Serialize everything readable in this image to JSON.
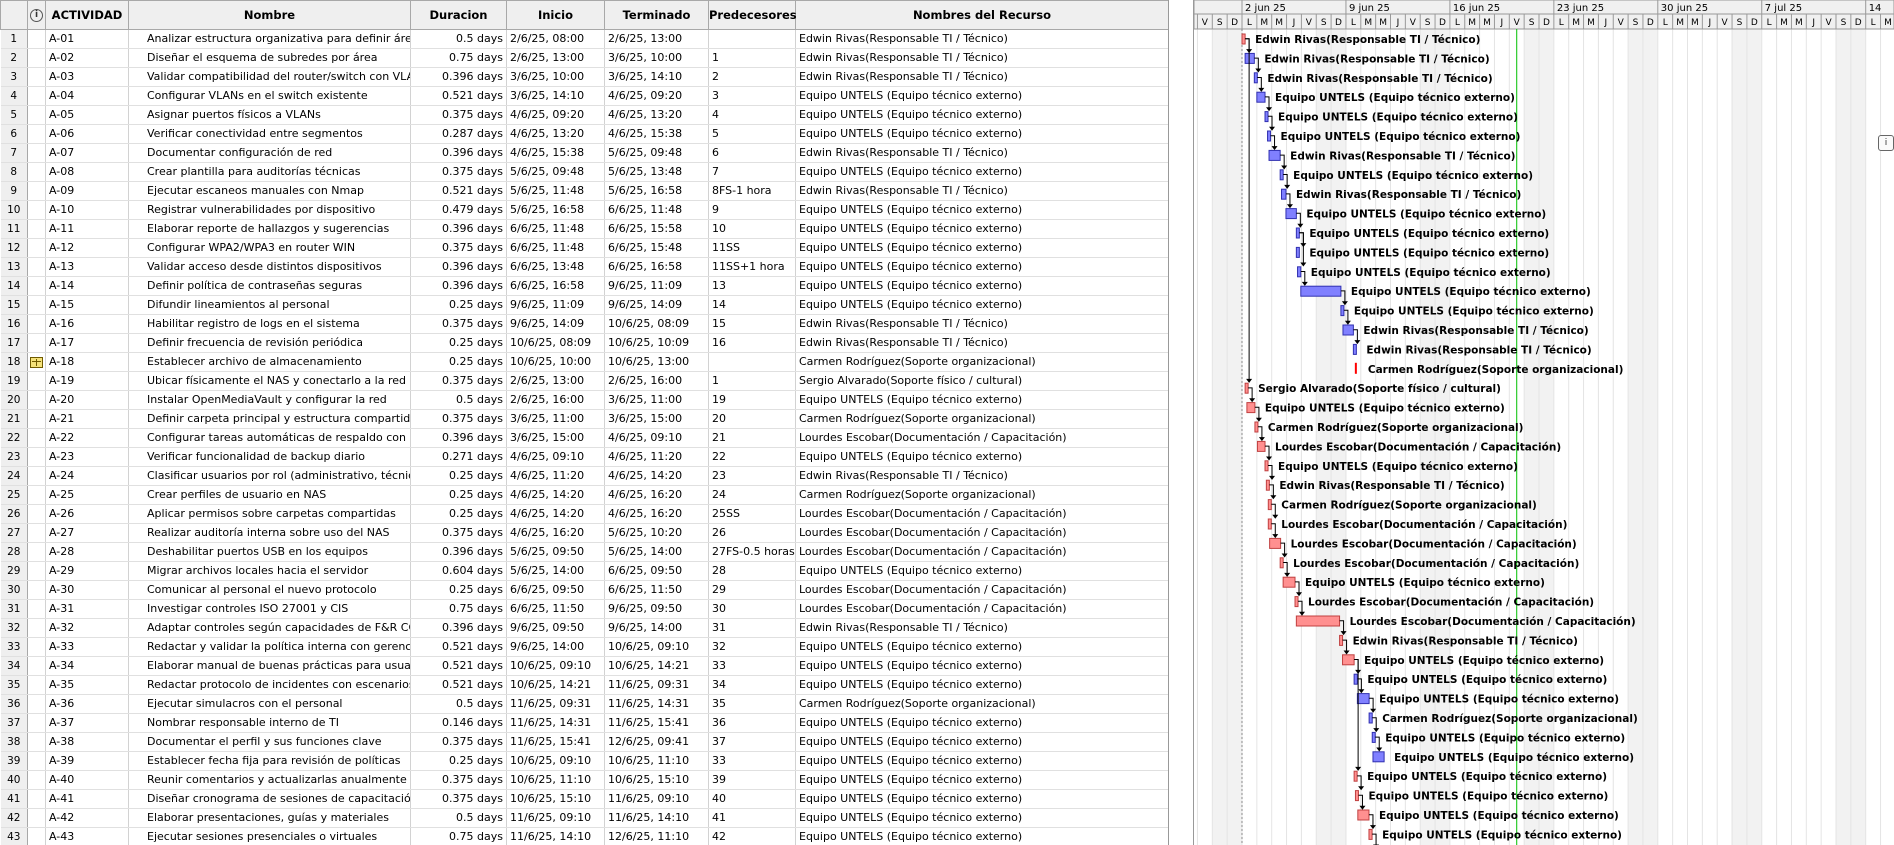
{
  "columns": {
    "info_icon": "info-icon",
    "actividad": "ACTIVIDAD",
    "nombre": "Nombre",
    "duracion": "Duracion",
    "inicio": "Inicio",
    "terminado": "Terminado",
    "predecesores": "Predecesores",
    "recursos": "Nombres del Recurso"
  },
  "colors": {
    "blue_bar": "#8080ff",
    "red_bar": "#ff9090",
    "milestone_red": "#ff0000",
    "today_line": "#00c000"
  },
  "tasks": [
    {
      "id": "1",
      "code": "A-01",
      "name": "Analizar estructura organizativa para definir áreas lógicas",
      "dur": "0.5 days",
      "start": "2/6/25, 08:00",
      "finish": "2/6/25, 13:00",
      "pred": "",
      "res": "Edwin Rivas(Responsable TI / Técnico)",
      "d0": 0,
      "d1": 0.21,
      "color": "red"
    },
    {
      "id": "2",
      "code": "A-02",
      "name": "Diseñar el esquema de subredes por área",
      "dur": "0.75 days",
      "start": "2/6/25, 13:00",
      "finish": "3/6/25, 10:00",
      "pred": "1",
      "res": "Edwin Rivas(Responsable TI / Técnico)",
      "d0": 0.21,
      "d1": 0.83,
      "color": "blue"
    },
    {
      "id": "3",
      "code": "A-03",
      "name": "Validar compatibilidad del router/switch con VLAN",
      "dur": "0.396 days",
      "start": "3/6/25, 10:00",
      "finish": "3/6/25, 14:10",
      "pred": "2",
      "res": "Edwin Rivas(Responsable TI / Técnico)",
      "d0": 0.83,
      "d1": 1.0,
      "color": "blue"
    },
    {
      "id": "4",
      "code": "A-04",
      "name": "Configurar VLANs en el switch existente",
      "dur": "0.521 days",
      "start": "3/6/25, 14:10",
      "finish": "4/6/25, 09:20",
      "pred": "3",
      "res": "Equipo UNTELS (Equipo técnico externo)",
      "d0": 1.0,
      "d1": 1.55,
      "color": "blue"
    },
    {
      "id": "5",
      "code": "A-05",
      "name": "Asignar puertos físicos a VLANs",
      "dur": "0.375 days",
      "start": "4/6/25, 09:20",
      "finish": "4/6/25, 13:20",
      "pred": "4",
      "res": "Equipo UNTELS (Equipo técnico externo)",
      "d0": 1.55,
      "d1": 1.72,
      "color": "blue"
    },
    {
      "id": "6",
      "code": "A-06",
      "name": "Verificar conectividad entre segmentos",
      "dur": "0.287 days",
      "start": "4/6/25, 13:20",
      "finish": "4/6/25, 15:38",
      "pred": "5",
      "res": "Equipo UNTELS (Equipo técnico externo)",
      "d0": 1.72,
      "d1": 1.82,
      "color": "blue"
    },
    {
      "id": "7",
      "code": "A-07",
      "name": "Documentar configuración de red",
      "dur": "0.396 days",
      "start": "4/6/25, 15:38",
      "finish": "5/6/25, 09:48",
      "pred": "6",
      "res": "Edwin Rivas(Responsable TI / Técnico)",
      "d0": 1.82,
      "d1": 2.57,
      "color": "blue"
    },
    {
      "id": "8",
      "code": "A-08",
      "name": "Crear plantilla para auditorías técnicas",
      "dur": "0.375 days",
      "start": "5/6/25, 09:48",
      "finish": "5/6/25, 13:48",
      "pred": "7",
      "res": "Equipo UNTELS (Equipo técnico externo)",
      "d0": 2.57,
      "d1": 2.74,
      "color": "blue"
    },
    {
      "id": "9",
      "code": "A-09",
      "name": "Ejecutar escaneos manuales con Nmap",
      "dur": "0.521 days",
      "start": "5/6/25, 11:48",
      "finish": "5/6/25, 16:58",
      "pred": "8FS-1 hora",
      "res": "Edwin Rivas(Responsable TI / Técnico)",
      "d0": 2.66,
      "d1": 2.96,
      "color": "blue"
    },
    {
      "id": "10",
      "code": "A-10",
      "name": "Registrar vulnerabilidades por dispositivo",
      "dur": "0.479 days",
      "start": "5/6/25, 16:58",
      "finish": "6/6/25, 11:48",
      "pred": "9",
      "res": "Equipo UNTELS (Equipo técnico externo)",
      "d0": 2.96,
      "d1": 3.66,
      "color": "blue"
    },
    {
      "id": "11",
      "code": "A-11",
      "name": "Elaborar reporte de hallazgos y sugerencias",
      "dur": "0.396 days",
      "start": "6/6/25, 11:48",
      "finish": "6/6/25, 15:58",
      "pred": "10",
      "res": "Equipo UNTELS (Equipo técnico externo)",
      "d0": 3.66,
      "d1": 3.83,
      "color": "blue"
    },
    {
      "id": "12",
      "code": "A-12",
      "name": "Configurar WPA2/WPA3 en router WIN",
      "dur": "0.375 days",
      "start": "6/6/25, 11:48",
      "finish": "6/6/25, 15:48",
      "pred": "11SS",
      "res": "Equipo UNTELS (Equipo técnico externo)",
      "d0": 3.66,
      "d1": 3.83,
      "color": "blue"
    },
    {
      "id": "13",
      "code": "A-13",
      "name": "Validar acceso desde distintos dispositivos",
      "dur": "0.396 days",
      "start": "6/6/25, 13:48",
      "finish": "6/6/25, 16:58",
      "pred": "11SS+1 hora",
      "res": "Equipo UNTELS (Equipo técnico externo)",
      "d0": 3.74,
      "d1": 3.96,
      "color": "blue"
    },
    {
      "id": "14",
      "code": "A-14",
      "name": "Definir política de contraseñas seguras",
      "dur": "0.396 days",
      "start": "6/6/25, 16:58",
      "finish": "9/6/25, 11:09",
      "pred": "13",
      "res": "Equipo UNTELS (Equipo técnico externo)",
      "d0": 3.96,
      "d1": 6.66,
      "color": "blue"
    },
    {
      "id": "15",
      "code": "A-15",
      "name": "Difundir lineamientos al personal",
      "dur": "0.25 days",
      "start": "9/6/25, 11:09",
      "finish": "9/6/25, 14:09",
      "pred": "14",
      "res": "Equipo UNTELS (Equipo técnico externo)",
      "d0": 6.66,
      "d1": 6.8,
      "color": "blue"
    },
    {
      "id": "16",
      "code": "A-16",
      "name": "Habilitar registro de logs en el sistema",
      "dur": "0.375 days",
      "start": "9/6/25, 14:09",
      "finish": "10/6/25, 08:09",
      "pred": "15",
      "res": "Edwin Rivas(Responsable TI / Técnico)",
      "d0": 6.8,
      "d1": 7.5,
      "color": "blue"
    },
    {
      "id": "17",
      "code": "A-17",
      "name": "Definir frecuencia de revisión periódica",
      "dur": "0.25 days",
      "start": "10/6/25, 08:09",
      "finish": "10/6/25, 10:09",
      "pred": "16",
      "res": "Edwin Rivas(Responsable TI / Técnico)",
      "d0": 7.5,
      "d1": 7.6,
      "color": "blue"
    },
    {
      "id": "18",
      "code": "A-18",
      "name": "Establecer archivo de almacenamiento",
      "dur": "0.25 days",
      "start": "10/6/25, 10:00",
      "finish": "10/6/25, 13:00",
      "pred": "",
      "res": "Carmen Rodríguez(Soporte organizacional)",
      "d0": 7.6,
      "d1": 7.62,
      "color": "milestone",
      "indicator": true
    },
    {
      "id": "19",
      "code": "A-19",
      "name": "Ubicar físicamente el NAS y conectarlo a la red",
      "dur": "0.375 days",
      "start": "2/6/25, 13:00",
      "finish": "2/6/25, 16:00",
      "pred": "1",
      "res": "Sergio Alvarado(Soporte físico / cultural)",
      "d0": 0.21,
      "d1": 0.33,
      "color": "red"
    },
    {
      "id": "20",
      "code": "A-20",
      "name": "Instalar OpenMediaVault y configurar la red",
      "dur": "0.5 days",
      "start": "2/6/25, 16:00",
      "finish": "3/6/25, 11:00",
      "pred": "19",
      "res": "Equipo UNTELS (Equipo técnico externo)",
      "d0": 0.33,
      "d1": 0.87,
      "color": "red"
    },
    {
      "id": "21",
      "code": "A-21",
      "name": "Definir carpeta principal y estructura compartida",
      "dur": "0.375 days",
      "start": "3/6/25, 11:00",
      "finish": "3/6/25, 15:00",
      "pred": "20",
      "res": "Carmen Rodríguez(Soporte organizacional)",
      "d0": 0.87,
      "d1": 1.04,
      "color": "red"
    },
    {
      "id": "22",
      "code": "A-22",
      "name": "Configurar tareas automáticas de respaldo con Cron",
      "dur": "0.396 days",
      "start": "3/6/25, 15:00",
      "finish": "4/6/25, 09:10",
      "pred": "21",
      "res": "Lourdes Escobar(Documentación / Capacitación)",
      "d0": 1.04,
      "d1": 1.55,
      "color": "red"
    },
    {
      "id": "23",
      "code": "A-23",
      "name": "Verificar funcionalidad de backup diario",
      "dur": "0.271 days",
      "start": "4/6/25, 09:10",
      "finish": "4/6/25, 11:20",
      "pred": "22",
      "res": "Equipo UNTELS (Equipo técnico externo)",
      "d0": 1.55,
      "d1": 1.64,
      "color": "red"
    },
    {
      "id": "24",
      "code": "A-24",
      "name": "Clasificar usuarios por rol (administrativo, técnico)",
      "dur": "0.25 days",
      "start": "4/6/25, 11:20",
      "finish": "4/6/25, 14:20",
      "pred": "23",
      "res": "Edwin Rivas(Responsable TI / Técnico)",
      "d0": 1.64,
      "d1": 1.77,
      "color": "red"
    },
    {
      "id": "25",
      "code": "A-25",
      "name": "Crear perfiles de usuario en NAS",
      "dur": "0.25 days",
      "start": "4/6/25, 14:20",
      "finish": "4/6/25, 16:20",
      "pred": "24",
      "res": "Carmen Rodríguez(Soporte organizacional)",
      "d0": 1.77,
      "d1": 1.86,
      "color": "red"
    },
    {
      "id": "26",
      "code": "A-26",
      "name": "Aplicar permisos sobre carpetas compartidas",
      "dur": "0.25 days",
      "start": "4/6/25, 14:20",
      "finish": "4/6/25, 16:20",
      "pred": "25SS",
      "res": "Lourdes Escobar(Documentación / Capacitación)",
      "d0": 1.77,
      "d1": 1.86,
      "color": "red"
    },
    {
      "id": "27",
      "code": "A-27",
      "name": "Realizar auditoría interna sobre uso del NAS",
      "dur": "0.375 days",
      "start": "4/6/25, 16:20",
      "finish": "5/6/25, 10:20",
      "pred": "26",
      "res": "Lourdes Escobar(Documentación / Capacitación)",
      "d0": 1.86,
      "d1": 2.6,
      "color": "red"
    },
    {
      "id": "28",
      "code": "A-28",
      "name": "Deshabilitar puertos USB en los equipos",
      "dur": "0.396 days",
      "start": "5/6/25, 09:50",
      "finish": "5/6/25, 14:00",
      "pred": "27FS-0.5 horas",
      "res": "Lourdes Escobar(Documentación / Capacitación)",
      "d0": 2.57,
      "d1": 2.77,
      "color": "red"
    },
    {
      "id": "29",
      "code": "A-29",
      "name": "Migrar archivos locales hacia el servidor",
      "dur": "0.604 days",
      "start": "5/6/25, 14:00",
      "finish": "6/6/25, 09:50",
      "pred": "28",
      "res": "Equipo UNTELS (Equipo técnico externo)",
      "d0": 2.77,
      "d1": 3.57,
      "color": "red"
    },
    {
      "id": "30",
      "code": "A-30",
      "name": "Comunicar al personal el nuevo protocolo",
      "dur": "0.25 days",
      "start": "6/6/25, 09:50",
      "finish": "6/6/25, 11:50",
      "pred": "29",
      "res": "Lourdes Escobar(Documentación / Capacitación)",
      "d0": 3.57,
      "d1": 3.66,
      "color": "red"
    },
    {
      "id": "31",
      "code": "A-31",
      "name": "Investigar controles ISO 27001 y CIS",
      "dur": "0.75 days",
      "start": "6/6/25, 11:50",
      "finish": "9/6/25, 09:50",
      "pred": "30",
      "res": "Lourdes Escobar(Documentación / Capacitación)",
      "d0": 3.66,
      "d1": 6.57,
      "color": "red"
    },
    {
      "id": "32",
      "code": "A-32",
      "name": "Adaptar controles según capacidades de F&R CORP",
      "dur": "0.396 days",
      "start": "9/6/25, 09:50",
      "finish": "9/6/25, 14:00",
      "pred": "31",
      "res": "Edwin Rivas(Responsable TI / Técnico)",
      "d0": 6.57,
      "d1": 6.77,
      "color": "red"
    },
    {
      "id": "33",
      "code": "A-33",
      "name": "Redactar y validar la política interna con gerencia",
      "dur": "0.521 days",
      "start": "9/6/25, 14:00",
      "finish": "10/6/25, 09:10",
      "pred": "32",
      "res": "Equipo UNTELS (Equipo técnico externo)",
      "d0": 6.77,
      "d1": 7.55,
      "color": "red"
    },
    {
      "id": "34",
      "code": "A-34",
      "name": "Elaborar manual de buenas prácticas para usuarios",
      "dur": "0.521 days",
      "start": "10/6/25, 09:10",
      "finish": "10/6/25, 14:21",
      "pred": "33",
      "res": "Equipo UNTELS (Equipo técnico externo)",
      "d0": 7.55,
      "d1": 7.77,
      "color": "blue"
    },
    {
      "id": "35",
      "code": "A-35",
      "name": "Redactar protocolo de incidentes con escenarios reales",
      "dur": "0.521 days",
      "start": "10/6/25, 14:21",
      "finish": "11/6/25, 09:31",
      "pred": "34",
      "res": "Equipo UNTELS (Equipo técnico externo)",
      "d0": 7.77,
      "d1": 8.56,
      "color": "blue"
    },
    {
      "id": "36",
      "code": "A-36",
      "name": "Ejecutar simulacros con el personal",
      "dur": "0.5 days",
      "start": "11/6/25, 09:31",
      "finish": "11/6/25, 14:31",
      "pred": "35",
      "res": "Carmen Rodríguez(Soporte organizacional)",
      "d0": 8.56,
      "d1": 8.77,
      "color": "blue"
    },
    {
      "id": "37",
      "code": "A-37",
      "name": "Nombrar responsable interno de TI",
      "dur": "0.146 days",
      "start": "11/6/25, 14:31",
      "finish": "11/6/25, 15:41",
      "pred": "36",
      "res": "Equipo UNTELS (Equipo técnico externo)",
      "d0": 8.77,
      "d1": 8.82,
      "color": "blue"
    },
    {
      "id": "38",
      "code": "A-38",
      "name": "Documentar el perfil y sus funciones clave",
      "dur": "0.375 days",
      "start": "11/6/25, 15:41",
      "finish": "12/6/25, 09:41",
      "pred": "37",
      "res": "Equipo UNTELS (Equipo técnico externo)",
      "d0": 8.82,
      "d1": 9.57,
      "color": "blue"
    },
    {
      "id": "39",
      "code": "A-39",
      "name": "Establecer fecha fija para revisión de políticas",
      "dur": "0.25 days",
      "start": "10/6/25, 09:10",
      "finish": "10/6/25, 11:10",
      "pred": "33",
      "res": "Equipo UNTELS (Equipo técnico externo)",
      "d0": 7.55,
      "d1": 7.64,
      "color": "red"
    },
    {
      "id": "40",
      "code": "A-40",
      "name": "Reunir comentarios y actualizarlas anualmente",
      "dur": "0.375 days",
      "start": "10/6/25, 11:10",
      "finish": "10/6/25, 15:10",
      "pred": "39",
      "res": "Equipo UNTELS (Equipo técnico externo)",
      "d0": 7.64,
      "d1": 7.8,
      "color": "red"
    },
    {
      "id": "41",
      "code": "A-41",
      "name": "Diseñar cronograma de sesiones de capacitación",
      "dur": "0.375 days",
      "start": "10/6/25, 15:10",
      "finish": "11/6/25, 09:10",
      "pred": "40",
      "res": "Equipo UNTELS (Equipo técnico externo)",
      "d0": 7.8,
      "d1": 8.55,
      "color": "red"
    },
    {
      "id": "42",
      "code": "A-42",
      "name": "Elaborar presentaciones, guías y materiales",
      "dur": "0.5 days",
      "start": "11/6/25, 09:10",
      "finish": "11/6/25, 14:10",
      "pred": "41",
      "res": "Equipo UNTELS (Equipo técnico externo)",
      "d0": 8.55,
      "d1": 8.76,
      "color": "red"
    },
    {
      "id": "43",
      "code": "A-43",
      "name": "Ejecutar sesiones presenciales o virtuales",
      "dur": "0.75 days",
      "start": "11/6/25, 14:10",
      "finish": "12/6/25, 11:10",
      "pred": "42",
      "res": "Equipo UNTELS (Equipo técnico externo)",
      "d0": 8.76,
      "d1": 9.63,
      "color": "red"
    }
  ],
  "gantt": {
    "weeks": [
      "2 jun 25",
      "9 jun 25",
      "16 jun 25",
      "23 jun 25",
      "30 jun 25",
      "7 jul 25",
      "14"
    ],
    "day_letters": [
      "V",
      "S",
      "D",
      "L",
      "M",
      "M",
      "J",
      "V",
      "S",
      "D",
      "L",
      "M",
      "M",
      "J",
      "V",
      "S",
      "D",
      "L",
      "M",
      "M",
      "J",
      "V",
      "S",
      "D",
      "L",
      "M",
      "M",
      "J",
      "V",
      "S",
      "D",
      "L",
      "M",
      "M",
      "J",
      "V",
      "S",
      "D",
      "L",
      "M",
      "M",
      "J",
      "V",
      "S",
      "D",
      "L",
      "M",
      "M",
      "J",
      "V",
      "S",
      "D",
      "L"
    ],
    "today_offset_days": 18.5,
    "dependencies": [
      [
        1,
        2
      ],
      [
        2,
        3
      ],
      [
        3,
        4
      ],
      [
        4,
        5
      ],
      [
        5,
        6
      ],
      [
        6,
        7
      ],
      [
        7,
        8
      ],
      [
        8,
        9
      ],
      [
        9,
        10
      ],
      [
        10,
        11
      ],
      [
        11,
        12
      ],
      [
        11,
        13
      ],
      [
        13,
        14
      ],
      [
        14,
        15
      ],
      [
        15,
        16
      ],
      [
        16,
        17
      ],
      [
        1,
        19
      ],
      [
        19,
        20
      ],
      [
        20,
        21
      ],
      [
        21,
        22
      ],
      [
        22,
        23
      ],
      [
        23,
        24
      ],
      [
        24,
        25
      ],
      [
        25,
        26
      ],
      [
        26,
        27
      ],
      [
        27,
        28
      ],
      [
        28,
        29
      ],
      [
        29,
        30
      ],
      [
        30,
        31
      ],
      [
        31,
        32
      ],
      [
        32,
        33
      ],
      [
        33,
        34
      ],
      [
        34,
        35
      ],
      [
        35,
        36
      ],
      [
        36,
        37
      ],
      [
        37,
        38
      ],
      [
        33,
        39
      ],
      [
        39,
        40
      ],
      [
        40,
        41
      ],
      [
        41,
        42
      ],
      [
        42,
        43
      ]
    ]
  },
  "right_edge_icon": "info-icon"
}
